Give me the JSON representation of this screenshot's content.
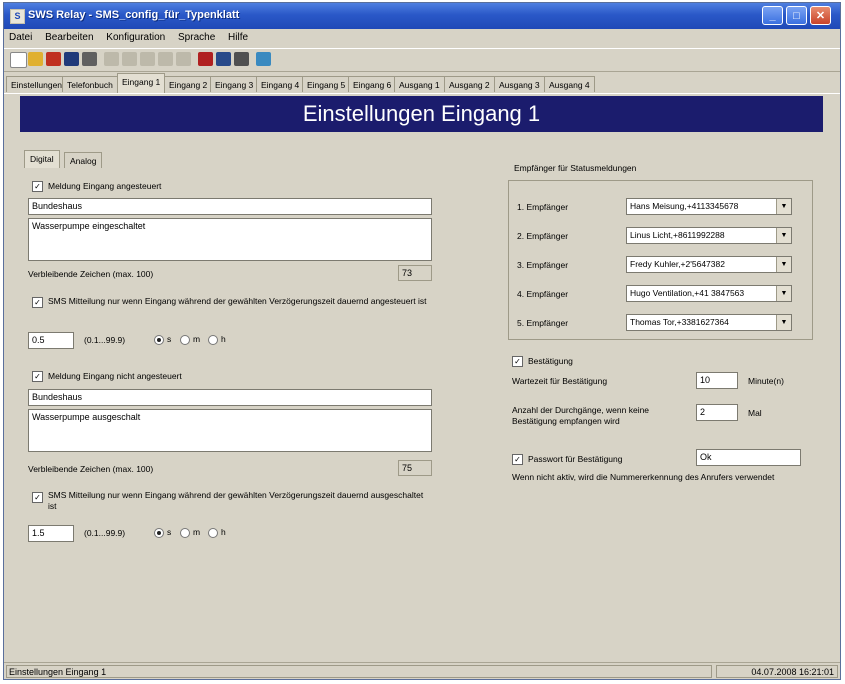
{
  "window": {
    "title": "SWS Relay - SMS_config_für_Typenklatt"
  },
  "menu": [
    "Datei",
    "Bearbeiten",
    "Konfiguration",
    "Sprache",
    "Hilfe"
  ],
  "tabs": [
    "Einstellungen",
    "Telefonbuch",
    "Eingang 1",
    "Eingang 2",
    "Eingang 3",
    "Eingang 4",
    "Eingang 5",
    "Eingang 6",
    "Ausgang 1",
    "Ausgang 2",
    "Ausgang 3",
    "Ausgang 4"
  ],
  "banner": "Einstellungen Eingang 1",
  "subtabs": [
    "Digital",
    "Analog"
  ],
  "section1": {
    "checkbox_label": "Meldung Eingang angesteuert",
    "field1": "Bundeshaus",
    "field2": "Wasserpumpe eingeschaltet",
    "remaining_label": "Verbleibende Zeichen (max. 100)",
    "remaining_value": "73",
    "delay_label": "SMS Mitteilung nur wenn Eingang während der gewählten Verzögerungszeit dauernd angesteuert ist",
    "delay_value": "0.5",
    "range": "(0.1...99.9)",
    "units": [
      "s",
      "m",
      "h"
    ]
  },
  "section2": {
    "checkbox_label": "Meldung Eingang nicht angesteuert",
    "field1": "Bundeshaus",
    "field2": "Wasserpumpe ausgeschalt",
    "remaining_label": "Verbleibende Zeichen (max. 100)",
    "remaining_value": "75",
    "delay_label": "SMS Mitteilung nur wenn Eingang während der gewählten Verzögerungszeit dauernd ausgeschaltet ist",
    "delay_value": "1.5",
    "range": "(0.1...99.9)",
    "units": [
      "s",
      "m",
      "h"
    ]
  },
  "recipients": {
    "title": "Empfänger für Statusmeldungen",
    "rows": [
      {
        "label": "1. Empfänger",
        "value": "Hans Meisung,+4113345678"
      },
      {
        "label": "2. Empfänger",
        "value": "Linus Licht,+8611992288"
      },
      {
        "label": "3. Empfänger",
        "value": "Fredy Kuhler,+2'5647382"
      },
      {
        "label": "4. Empfänger",
        "value": "Hugo Ventilation,+41 3847563"
      },
      {
        "label": "5. Empfänger",
        "value": "Thomas Tor,+3381627364"
      }
    ]
  },
  "confirm": {
    "checkbox_label": "Bestätigung",
    "wait_label": "Wartezeit für Bestätigung",
    "wait_value": "10",
    "wait_unit": "Minute(n)",
    "passes_label": "Anzahl der Durchgänge, wenn keine Bestätigung empfangen wird",
    "passes_value": "2",
    "passes_unit": "Mal",
    "password_label": "Passwort für Bestätigung",
    "password_value": "Ok",
    "note": "Wenn nicht aktiv, wird die Nummererkennung des Anrufers verwendet"
  },
  "status": {
    "left": "Einstellungen Eingang 1",
    "right": "04.07.2008 16:21:01"
  }
}
